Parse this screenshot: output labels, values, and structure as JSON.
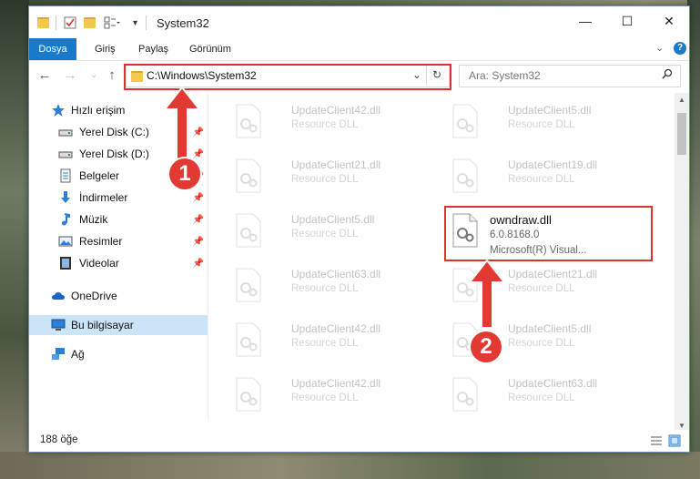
{
  "window": {
    "title": "System32",
    "controls": {
      "minimize": "—",
      "maximize": "☐",
      "close": "✕"
    }
  },
  "ribbon": {
    "tabs": [
      "Dosya",
      "Giriş",
      "Paylaş",
      "Görünüm"
    ]
  },
  "address": {
    "path": "C:\\Windows\\System32",
    "search_placeholder": "Ara: System32"
  },
  "sidebar": {
    "items": [
      {
        "label": "Hızlı erişim",
        "icon": "star-icon",
        "pinned": false
      },
      {
        "label": "Yerel Disk (C:)",
        "icon": "drive-icon",
        "pinned": true
      },
      {
        "label": "Yerel Disk (D:)",
        "icon": "drive-icon",
        "pinned": true
      },
      {
        "label": "Belgeler",
        "icon": "document-icon",
        "pinned": true
      },
      {
        "label": "İndirmeler",
        "icon": "download-icon",
        "pinned": true
      },
      {
        "label": "Müzik",
        "icon": "music-icon",
        "pinned": true
      },
      {
        "label": "Resimler",
        "icon": "pictures-icon",
        "pinned": true
      },
      {
        "label": "Videolar",
        "icon": "video-icon",
        "pinned": true
      },
      {
        "label": "OneDrive",
        "icon": "cloud-icon",
        "pinned": false
      },
      {
        "label": "Bu bilgisayar",
        "icon": "computer-icon",
        "pinned": false,
        "selected": true
      },
      {
        "label": "Ağ",
        "icon": "network-icon",
        "pinned": false
      }
    ]
  },
  "files": [
    {
      "name": "UpdateClient42.dll",
      "type": "Resource DLL",
      "faded": true
    },
    {
      "name": "UpdateClient5.dll",
      "type": "Resource DLL",
      "faded": true
    },
    {
      "name": "UpdateClient21.dll",
      "type": "Resource DLL",
      "faded": true
    },
    {
      "name": "UpdateClient19.dll",
      "type": "Resource DLL",
      "faded": true
    },
    {
      "name": "UpdateClient5.dll",
      "type": "Resource DLL",
      "faded": true
    },
    {
      "name": "owndraw.dll",
      "version": "6.0.8168.0",
      "company": "Microsoft(R) Visual...",
      "faded": false
    },
    {
      "name": "UpdateClient63.dll",
      "type": "Resource DLL",
      "faded": true
    },
    {
      "name": "UpdateClient21.dll",
      "type": "Resource DLL",
      "faded": true
    },
    {
      "name": "UpdateClient42.dll",
      "type": "Resource DLL",
      "faded": true
    },
    {
      "name": "UpdateClient5.dll",
      "type": "Resource DLL",
      "faded": true
    },
    {
      "name": "UpdateClient42.dll",
      "type": "Resource DLL",
      "faded": true
    },
    {
      "name": "UpdateClient63.dll",
      "type": "Resource DLL",
      "faded": true
    }
  ],
  "annotations": {
    "step1": "1",
    "step2": "2"
  },
  "status": {
    "item_count": "188 öğe"
  },
  "colors": {
    "accent": "#1979ca",
    "highlight": "#d9342b",
    "selected": "#cce4f7"
  }
}
